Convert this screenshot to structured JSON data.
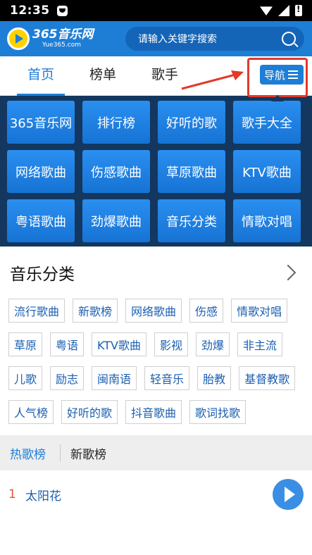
{
  "status_bar": {
    "time": "12:35"
  },
  "app": {
    "logo_title": "365音乐网",
    "logo_subtitle": "Yue365.com"
  },
  "search": {
    "placeholder": "请输入关键字搜索"
  },
  "tabs": [
    {
      "label": "首页",
      "active": true
    },
    {
      "label": "榜单",
      "active": false
    },
    {
      "label": "歌手",
      "active": false
    }
  ],
  "nav_button": {
    "label": "导航"
  },
  "nav_panel": {
    "items": [
      "365音乐网",
      "排行榜",
      "好听的歌",
      "歌手大全",
      "网络歌曲",
      "伤感歌曲",
      "草原歌曲",
      "KTV歌曲",
      "粤语歌曲",
      "劲爆歌曲",
      "音乐分类",
      "情歌对唱"
    ]
  },
  "category": {
    "title": "音乐分类",
    "tags": [
      "流行歌曲",
      "新歌榜",
      "网络歌曲",
      "伤感",
      "情歌对唱",
      "草原",
      "粤语",
      "KTV歌曲",
      "影视",
      "劲爆",
      "非主流",
      "儿歌",
      "励志",
      "闽南语",
      "轻音乐",
      "胎教",
      "基督教歌",
      "人气榜",
      "好听的歌",
      "抖音歌曲",
      "歌词找歌"
    ]
  },
  "chart_tabs": [
    {
      "label": "热歌榜",
      "active": true
    },
    {
      "label": "新歌榜",
      "active": false
    }
  ],
  "songs": [
    {
      "rank": "1",
      "title": "太阳花"
    }
  ],
  "colors": {
    "brand": "#1e7ed6",
    "panel": "#13375f",
    "highlight": "#e23a2a",
    "rank": "#e1562c"
  }
}
